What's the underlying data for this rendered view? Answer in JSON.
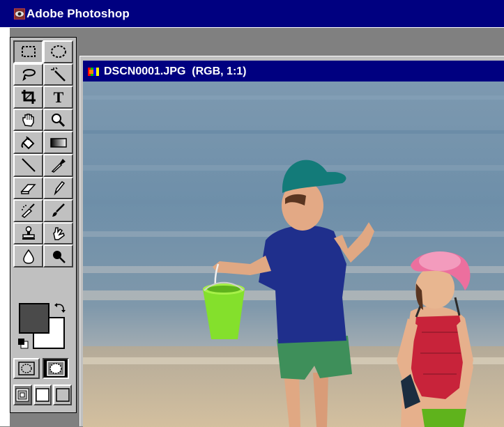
{
  "app": {
    "title": "Adobe Photoshop",
    "icon": "photoshop-eye-icon"
  },
  "toolbox": {
    "tools": [
      {
        "name": "rectangular-marquee-tool",
        "icon": "marquee-rect-icon",
        "active": true
      },
      {
        "name": "elliptical-marquee-tool",
        "icon": "marquee-ellipse-icon"
      },
      {
        "name": "lasso-tool",
        "icon": "lasso-icon"
      },
      {
        "name": "magic-wand-tool",
        "icon": "magic-wand-icon"
      },
      {
        "name": "crop-tool",
        "icon": "crop-icon"
      },
      {
        "name": "type-tool",
        "icon": "type-icon",
        "glyph": "T"
      },
      {
        "name": "hand-tool",
        "icon": "hand-icon"
      },
      {
        "name": "zoom-tool",
        "icon": "zoom-icon"
      },
      {
        "name": "paint-bucket-tool",
        "icon": "paint-bucket-icon"
      },
      {
        "name": "gradient-tool",
        "icon": "gradient-icon"
      },
      {
        "name": "line-tool",
        "icon": "line-icon"
      },
      {
        "name": "eyedropper-tool",
        "icon": "eyedropper-icon"
      },
      {
        "name": "eraser-tool",
        "icon": "eraser-icon"
      },
      {
        "name": "pencil-tool",
        "icon": "pencil-icon"
      },
      {
        "name": "airbrush-tool",
        "icon": "airbrush-icon"
      },
      {
        "name": "paintbrush-tool",
        "icon": "paintbrush-icon"
      },
      {
        "name": "rubber-stamp-tool",
        "icon": "rubber-stamp-icon"
      },
      {
        "name": "smudge-tool",
        "icon": "smudge-icon"
      },
      {
        "name": "blur-tool",
        "icon": "blur-drop-icon"
      },
      {
        "name": "dodge-burn-tool",
        "icon": "dodge-icon"
      }
    ],
    "foreground_color": "#4a4a4a",
    "background_color": "#ffffff",
    "mask_modes": [
      "standard-mode",
      "quick-mask-mode"
    ],
    "screen_modes": [
      "standard-screen-mode",
      "full-screen-menu-mode",
      "full-screen-mode"
    ]
  },
  "document": {
    "title": "DSCN0001.JPG  (RGB, 1:1)",
    "icon": "document-rgb-icon",
    "image_subject": "photo"
  },
  "colors": {
    "titlebar": "#000080",
    "workspace": "#808080",
    "panel": "#c0c0c0"
  }
}
